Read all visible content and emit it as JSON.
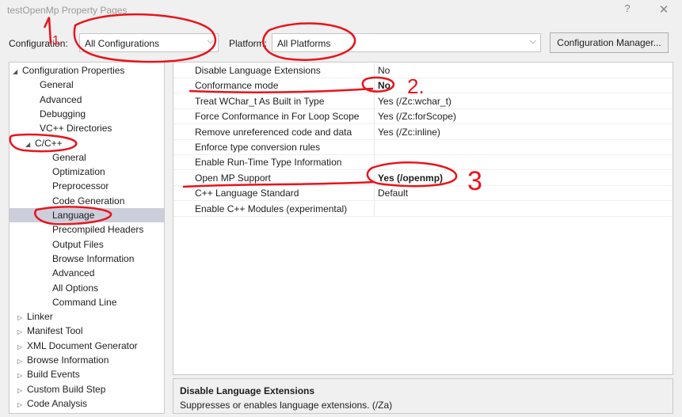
{
  "window": {
    "title": "testOpenMp Property Pages",
    "help": "?",
    "close": "✕"
  },
  "config_row": {
    "configuration_label": "Configuration:",
    "configuration_value": "All Configurations",
    "platform_label": "Platform:",
    "platform_value": "All Platforms",
    "config_manager_button": "Configuration Manager..."
  },
  "tree": {
    "items": [
      {
        "label": "Configuration Properties",
        "expander": "◢"
      },
      {
        "label": "General"
      },
      {
        "label": "Advanced"
      },
      {
        "label": "Debugging"
      },
      {
        "label": "VC++ Directories"
      },
      {
        "label": "C/C++",
        "expander": "◢"
      },
      {
        "label": "General"
      },
      {
        "label": "Optimization"
      },
      {
        "label": "Preprocessor"
      },
      {
        "label": "Code Generation"
      },
      {
        "label": "Language",
        "selected": true
      },
      {
        "label": "Precompiled Headers"
      },
      {
        "label": "Output Files"
      },
      {
        "label": "Browse Information"
      },
      {
        "label": "Advanced"
      },
      {
        "label": "All Options"
      },
      {
        "label": "Command Line"
      },
      {
        "label": "Linker",
        "expander": "▷"
      },
      {
        "label": "Manifest Tool",
        "expander": "▷"
      },
      {
        "label": "XML Document Generator",
        "expander": "▷"
      },
      {
        "label": "Browse Information",
        "expander": "▷"
      },
      {
        "label": "Build Events",
        "expander": "▷"
      },
      {
        "label": "Custom Build Step",
        "expander": "▷"
      },
      {
        "label": "Code Analysis",
        "expander": "▷"
      }
    ]
  },
  "properties": [
    {
      "name": "Disable Language Extensions",
      "value": "No"
    },
    {
      "name": "Conformance mode",
      "value": "No",
      "bold": true
    },
    {
      "name": "Treat WChar_t As Built in Type",
      "value": "Yes (/Zc:wchar_t)"
    },
    {
      "name": "Force Conformance in For Loop Scope",
      "value": "Yes (/Zc:forScope)"
    },
    {
      "name": "Remove unreferenced code and data",
      "value": "Yes (/Zc:inline)"
    },
    {
      "name": "Enforce type conversion rules",
      "value": ""
    },
    {
      "name": "Enable Run-Time Type Information",
      "value": ""
    },
    {
      "name": "Open MP Support",
      "value": "Yes (/openmp)",
      "bold": true
    },
    {
      "name": "C++ Language Standard",
      "value": "Default"
    },
    {
      "name": "Enable C++ Modules (experimental)",
      "value": ""
    }
  ],
  "description": {
    "title": "Disable Language Extensions",
    "text": "Suppresses or enables language extensions.    (/Za)"
  },
  "annotations": {
    "n1": "1.",
    "n2": "2.",
    "n3": "3",
    "color": "#e8141c"
  }
}
